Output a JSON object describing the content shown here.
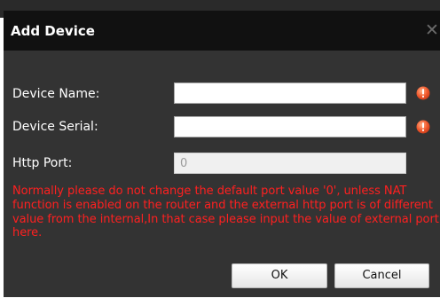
{
  "dialog": {
    "title": "Add Device",
    "close_icon": "close-icon"
  },
  "form": {
    "device_name": {
      "label": "Device Name:",
      "value": "",
      "icon": "warning-icon",
      "icon_color": "#e84a28"
    },
    "device_serial": {
      "label": "Device Serial:",
      "value": "",
      "icon": "warning-icon",
      "icon_color": "#e84a28"
    },
    "http_port": {
      "label": "Http Port:",
      "value": "0",
      "disabled": true
    },
    "note": "Normally please do not change the default port value '0', unless NAT function is enabled on the router and the external http port is of different value from the internal,In that case please input the value of external port here.",
    "note_color": "#ff2020"
  },
  "buttons": {
    "ok_label": "OK",
    "cancel_label": "Cancel"
  }
}
